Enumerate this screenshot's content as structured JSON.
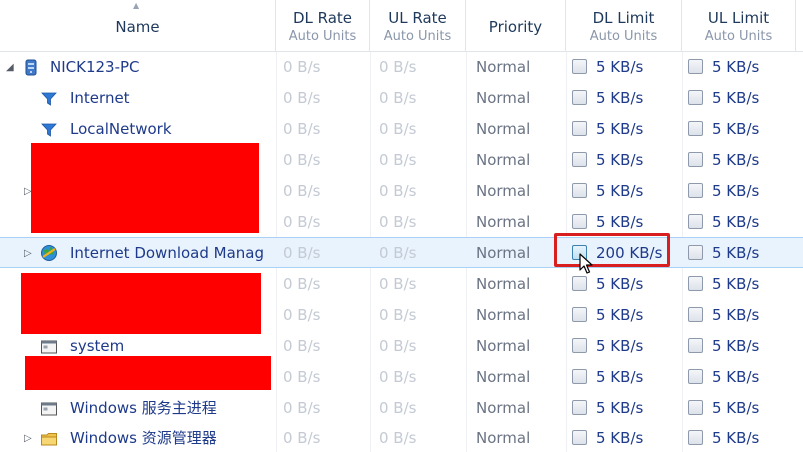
{
  "header": {
    "name": "Name",
    "dl_rate": "DL Rate",
    "dl_rate_sub": "Auto Units",
    "ul_rate": "UL Rate",
    "ul_rate_sub": "Auto Units",
    "priority": "Priority",
    "dl_limit": "DL Limit",
    "dl_limit_sub": "Auto Units",
    "ul_limit": "UL Limit",
    "ul_limit_sub": "Auto Units"
  },
  "rows": [
    {
      "name": "NICK123-PC",
      "dl": "0 B/s",
      "ul": "0 B/s",
      "priority": "Normal",
      "dl_limit": "5 KB/s",
      "ul_limit": "5 KB/s"
    },
    {
      "name": "Internet",
      "dl": "0 B/s",
      "ul": "0 B/s",
      "priority": "Normal",
      "dl_limit": "5 KB/s",
      "ul_limit": "5 KB/s"
    },
    {
      "name": "LocalNetwork",
      "dl": "0 B/s",
      "ul": "0 B/s",
      "priority": "Normal",
      "dl_limit": "5 KB/s",
      "ul_limit": "5 KB/s"
    },
    {
      "name": "",
      "dl": "0 B/s",
      "ul": "0 B/s",
      "priority": "Normal",
      "dl_limit": "5 KB/s",
      "ul_limit": "5 KB/s"
    },
    {
      "name": "",
      "dl": "0 B/s",
      "ul": "0 B/s",
      "priority": "Normal",
      "dl_limit": "5 KB/s",
      "ul_limit": "5 KB/s"
    },
    {
      "name": "",
      "dl": "0 B/s",
      "ul": "0 B/s",
      "priority": "Normal",
      "dl_limit": "5 KB/s",
      "ul_limit": "5 KB/s"
    },
    {
      "name": "Internet Download Manag",
      "dl": "0 B/s",
      "ul": "0 B/s",
      "priority": "Normal",
      "dl_limit": "200 KB/s",
      "ul_limit": "5 KB/s"
    },
    {
      "name": "",
      "dl": "0 B/s",
      "ul": "0 B/s",
      "priority": "Normal",
      "dl_limit": "5 KB/s",
      "ul_limit": "5 KB/s"
    },
    {
      "name": "",
      "dl": "0 B/s",
      "ul": "0 B/s",
      "priority": "Normal",
      "dl_limit": "5 KB/s",
      "ul_limit": "5 KB/s"
    },
    {
      "name": "system",
      "dl": "0 B/s",
      "ul": "0 B/s",
      "priority": "Normal",
      "dl_limit": "5 KB/s",
      "ul_limit": "5 KB/s"
    },
    {
      "name": "",
      "dl": "0 B/s",
      "ul": "0 B/s",
      "priority": "Normal",
      "dl_limit": "5 KB/s",
      "ul_limit": "5 KB/s"
    },
    {
      "name": "Windows 服务主进程",
      "dl": "0 B/s",
      "ul": "0 B/s",
      "priority": "Normal",
      "dl_limit": "5 KB/s",
      "ul_limit": "5 KB/s"
    },
    {
      "name": "Windows 资源管理器",
      "dl": "0 B/s",
      "ul": "0 B/s",
      "priority": "Normal",
      "dl_limit": "5 KB/s",
      "ul_limit": "5 KB/s"
    }
  ],
  "colors": {
    "selection": "#e9f3fd",
    "highlight_border": "#d81e1e",
    "redaction": "#ff0000"
  },
  "icons": {
    "root": "computer-icon",
    "filter": "filter-icon",
    "app": "idm-globe-icon",
    "process": "window-icon",
    "folder": "folder-icon"
  }
}
